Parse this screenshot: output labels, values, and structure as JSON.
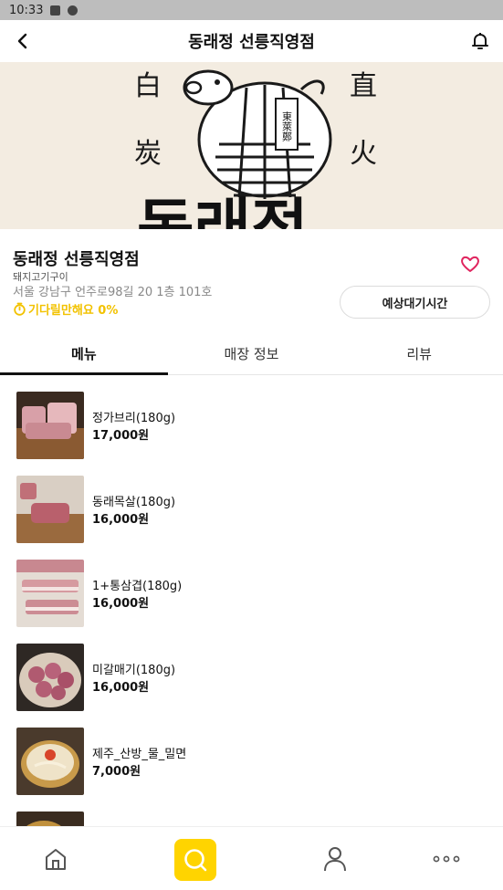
{
  "status_bar": {
    "time": "10:33"
  },
  "header": {
    "title": "동래정 선릉직영점"
  },
  "store": {
    "name": "동래정 선릉직영점",
    "category": "돼지고기구이",
    "address": "서울 강남구 언주로98길 20 1층 101호",
    "wait_text": "기다릴만해요 0%",
    "wait_button": "예상대기시간"
  },
  "tabs": [
    {
      "label": "메뉴"
    },
    {
      "label": "매장 정보"
    },
    {
      "label": "리뷰"
    }
  ],
  "menu": [
    {
      "name": "정가브리(180g)",
      "price": "17,000원"
    },
    {
      "name": "동래목살(180g)",
      "price": "16,000원"
    },
    {
      "name": "1+통삼겹(180g)",
      "price": "16,000원"
    },
    {
      "name": "미갈매기(180g)",
      "price": "16,000원"
    },
    {
      "name": "제주_산방_물_밀면",
      "price": "7,000원"
    },
    {
      "name": "",
      "price": ""
    }
  ],
  "hero": {
    "chars": [
      "白",
      "炭",
      "直",
      "火"
    ],
    "seal": "東萊鄭",
    "banner_text": "동래정"
  },
  "colors": {
    "accent": "#ffd400",
    "wait_text": "#f2c200",
    "heart": "#e0245e",
    "hero_bg": "#f3ece1"
  },
  "icons": {
    "back": "back-arrow-icon",
    "bell": "bell-icon",
    "heart": "heart-icon",
    "timer": "timer-icon",
    "home": "home-icon",
    "search": "search-icon",
    "user": "user-icon",
    "more": "more-icon"
  }
}
